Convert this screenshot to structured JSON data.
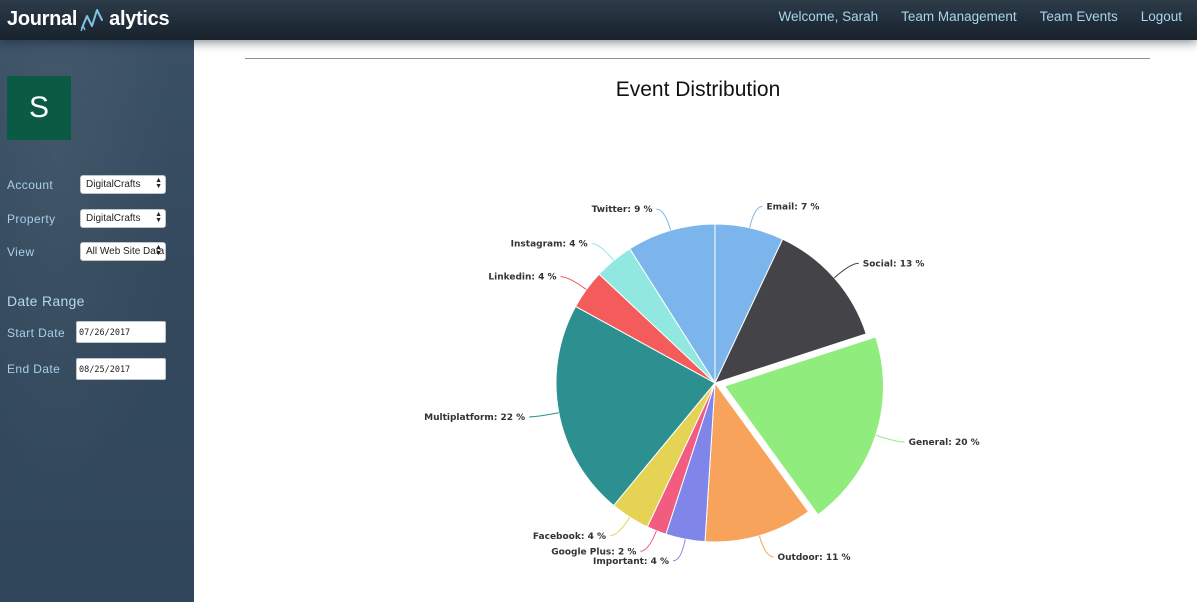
{
  "brand": {
    "name_part1": "Journal",
    "name_part2": "alytics"
  },
  "nav": {
    "welcome": "Welcome, Sarah",
    "team_management": "Team Management",
    "team_events": "Team Events",
    "logout": "Logout"
  },
  "sidebar": {
    "avatar_initial": "S",
    "account_label": "Account",
    "account_value": "DigitalCrafts",
    "property_label": "Property",
    "property_value": "DigitalCrafts",
    "view_label": "View",
    "view_value": "All Web Site Data",
    "date_range_heading": "Date Range",
    "start_date_label": "Start Date",
    "start_date_value": "07/26/2017",
    "end_date_label": "End Date",
    "end_date_value": "08/25/2017"
  },
  "chart_data": {
    "type": "pie",
    "title": "Event Distribution",
    "slices": [
      {
        "label": "Email: 7 %",
        "value": 7,
        "color": "#7cb5ec"
      },
      {
        "label": "Social: 13 %",
        "value": 13,
        "color": "#434348"
      },
      {
        "label": "General: 20 %",
        "value": 20,
        "color": "#90ed7d",
        "exploded": true
      },
      {
        "label": "Outdoor: 11 %",
        "value": 11,
        "color": "#f7a35c"
      },
      {
        "label": "Important: 4 %",
        "value": 4,
        "color": "#8085e9"
      },
      {
        "label": "Google Plus: 2 %",
        "value": 2,
        "color": "#f15c80"
      },
      {
        "label": "Facebook: 4 %",
        "value": 4,
        "color": "#e4d354"
      },
      {
        "label": "Multiplatform: 22 %",
        "value": 22,
        "color": "#2b908f"
      },
      {
        "label": "Linkedin: 4 %",
        "value": 4,
        "color": "#f45b5b"
      },
      {
        "label": "Instagram: 4 %",
        "value": 4,
        "color": "#91e8e1"
      },
      {
        "label": "Twitter: 9 %",
        "value": 9,
        "color": "#7cb5ec"
      }
    ]
  }
}
